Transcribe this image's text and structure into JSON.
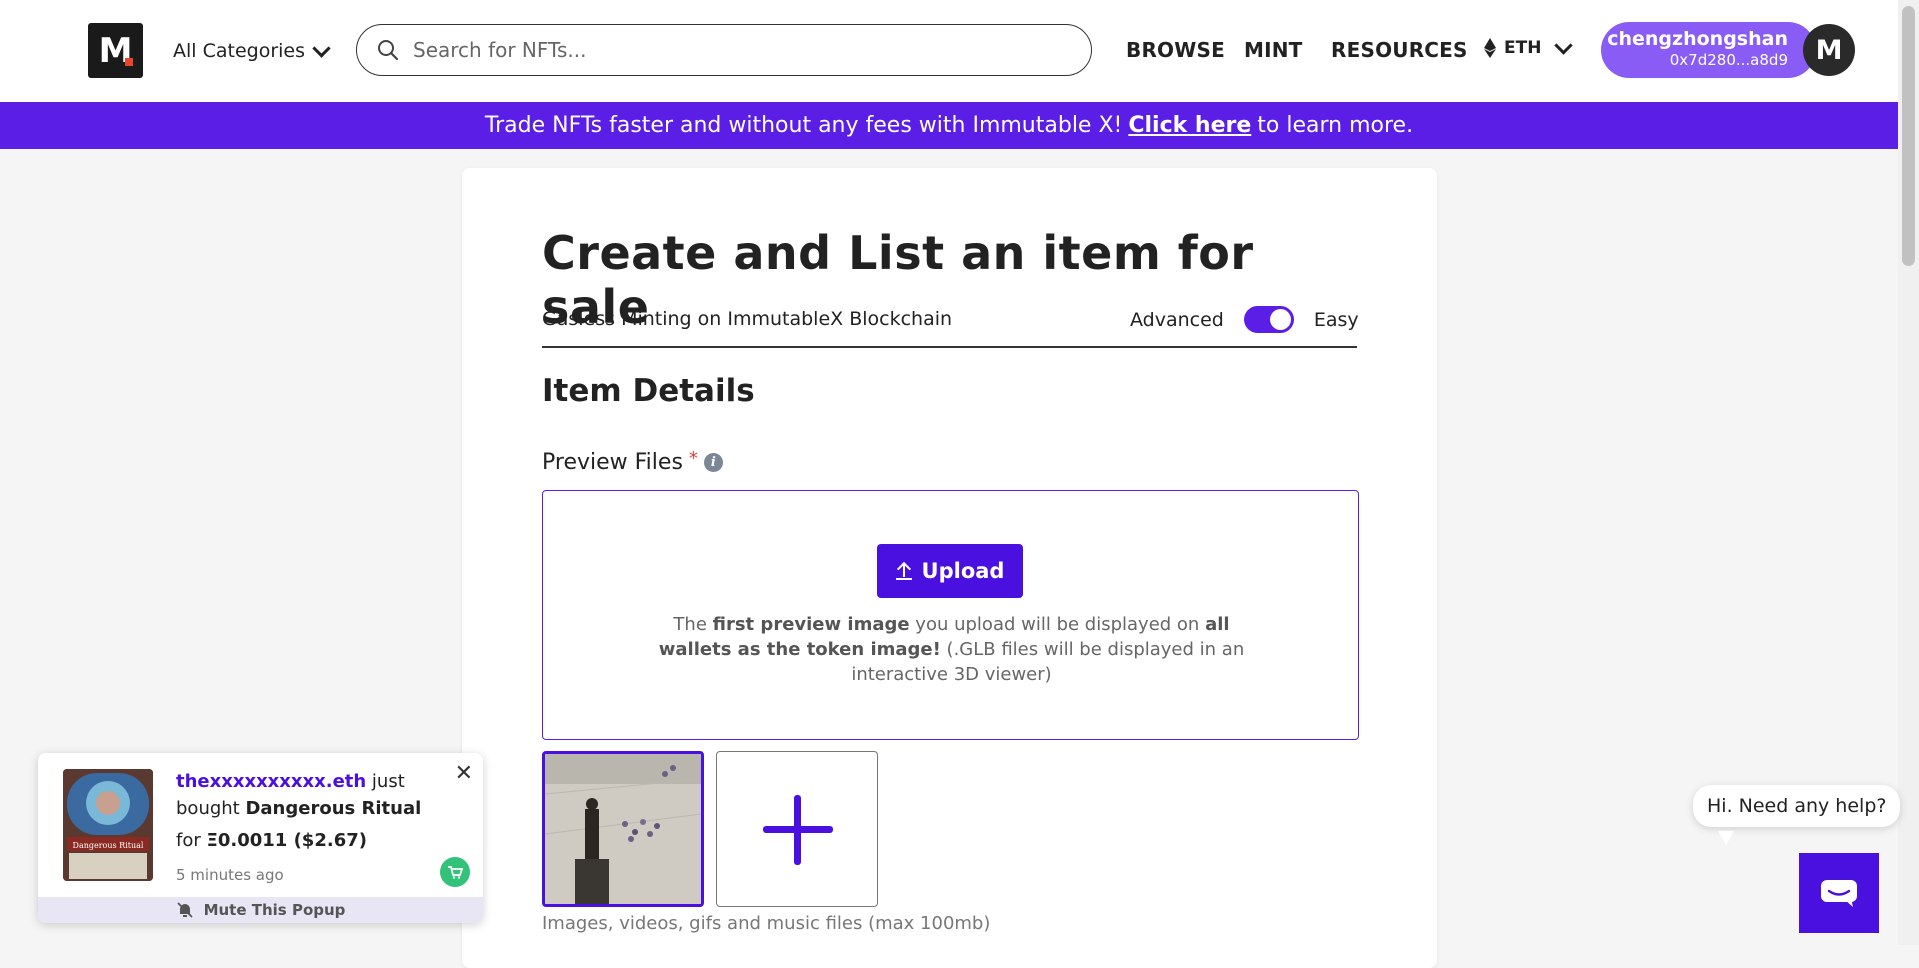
{
  "header": {
    "logo_letter": "M",
    "categories_label": "All Categories",
    "search_placeholder": "Search for NFTs...",
    "nav": {
      "browse": "BROWSE",
      "mint": "MINT",
      "resources": "RESOURCES"
    },
    "currency": "ETH",
    "user_name": "chengzhongshan",
    "user_address": "0x7d280...a8d9",
    "avatar_letter": "M"
  },
  "banner": {
    "text_before": "Trade NFTs faster and without any fees with Immutable X!",
    "link_text": "Click here",
    "text_after": "to learn more."
  },
  "form": {
    "title": "Create and List an item for sale",
    "subtitle": "Gasless Minting on ImmutableX Blockchain",
    "toggle_left": "Advanced",
    "toggle_right": "Easy",
    "toggle_on": true,
    "section_heading": "Item Details",
    "preview_label": "Preview Files",
    "required_mark": "*",
    "upload_label": "Upload",
    "drop_text": {
      "p1": "The ",
      "b1": "first preview image",
      "p2": " you upload will be displayed on ",
      "b2": "all wallets as the token image!",
      "p3": " (.GLB files will be displayed in an interactive 3D viewer)"
    },
    "hint": "Images, videos, gifs and music files (max 100mb)"
  },
  "popup": {
    "buyer": "thexxxxxxxxxx.eth",
    "action": " just bought ",
    "item": "Dangerous Ritual",
    "price_prefix": "for ",
    "price": "Ξ0.0011 ($2.67)",
    "time": "5 minutes ago",
    "mute_label": "Mute This Popup",
    "card_name": "Dangerous Ritual"
  },
  "help": {
    "bubble": "Hi. Need any help?"
  },
  "colors": {
    "accent": "#5b1ee6",
    "button": "#4a10df",
    "pill": "#8a5cf6",
    "cart": "#33c27a"
  }
}
